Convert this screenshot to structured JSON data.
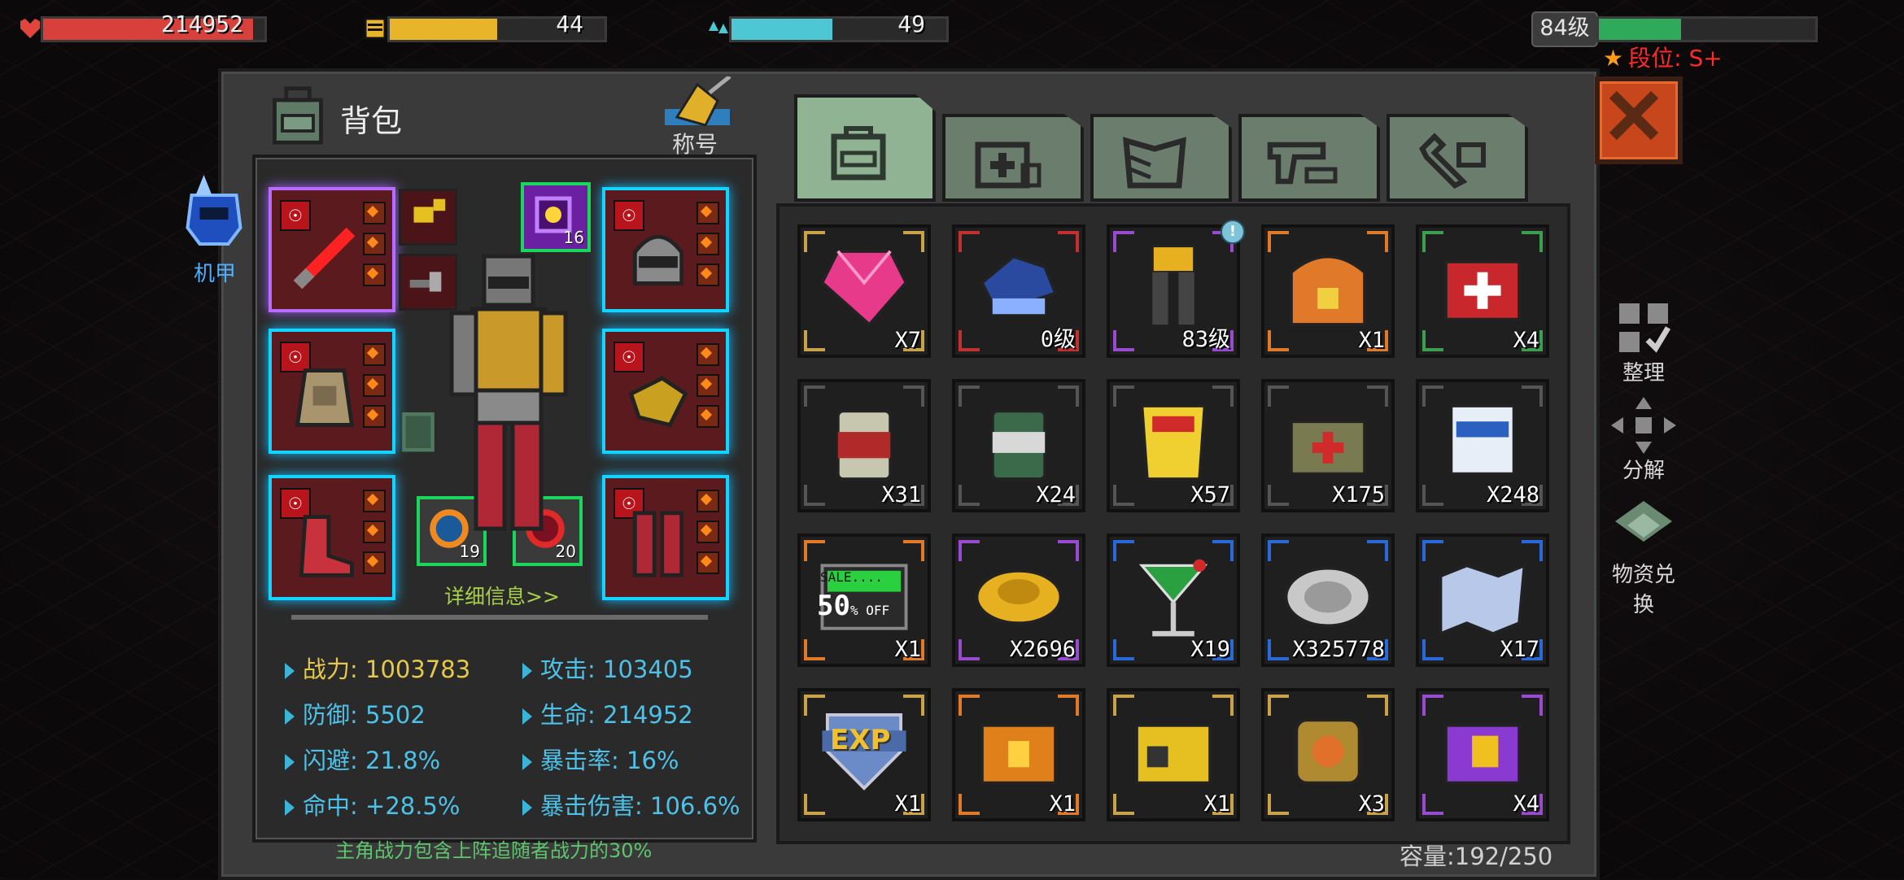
{
  "hud": {
    "hp": {
      "value": "214952",
      "fill": 0.95,
      "color": "#d8403c"
    },
    "energy": {
      "value": "44",
      "fill": 0.5,
      "color": "#e8b42a"
    },
    "water": {
      "value": "49",
      "fill": 0.47,
      "color": "#4ec7d4"
    },
    "level": {
      "label": "84级",
      "xp_fill": 0.38,
      "color": "#2eaa5a"
    },
    "rank": "段位: S+"
  },
  "panel": {
    "title": "背包",
    "title_badge_label": "称号",
    "mech_label": "机甲",
    "detail_link": "详细信息>>",
    "equipment_chips": [
      "16",
      "19",
      "20"
    ],
    "stats": [
      {
        "label": "战力",
        "value": "1003783"
      },
      {
        "label": "攻击",
        "value": "103405"
      },
      {
        "label": "防御",
        "value": "5502"
      },
      {
        "label": "生命",
        "value": "214952"
      },
      {
        "label": "闪避",
        "value": "21.8%"
      },
      {
        "label": "暴击率",
        "value": "16%"
      },
      {
        "label": "命中",
        "value": "+28.5%"
      },
      {
        "label": "暴击伤害",
        "value": "106.6%"
      }
    ],
    "note": "主角战力包含上阵追随者战力的30%"
  },
  "tabs": [
    {
      "icon": "backpack-icon",
      "active": true
    },
    {
      "icon": "medkit-icon",
      "active": false
    },
    {
      "icon": "armor-icon",
      "active": false
    },
    {
      "icon": "gun-icon",
      "active": false
    },
    {
      "icon": "wrench-icon",
      "active": false
    }
  ],
  "items": [
    {
      "name": "pink-gem",
      "qty": "X7",
      "frame": "#c9a24a"
    },
    {
      "name": "mech-glove",
      "qty": "0级",
      "frame": "#c23030"
    },
    {
      "name": "mech-legs",
      "qty": "83级",
      "frame": "#9a4ad0",
      "badge": "!"
    },
    {
      "name": "orange-crate",
      "qty": "X1",
      "frame": "#e07a2a"
    },
    {
      "name": "medical-pack",
      "qty": "X4",
      "frame": "#3aa050"
    },
    {
      "name": "bean-can",
      "qty": "X31",
      "frame": "#555555"
    },
    {
      "name": "soup-can",
      "qty": "X24",
      "frame": "#555555"
    },
    {
      "name": "chips-bag",
      "qty": "X57",
      "frame": "#555555"
    },
    {
      "name": "first-aid-bag",
      "qty": "X175",
      "frame": "#555555"
    },
    {
      "name": "salt-bag",
      "qty": "X248",
      "frame": "#555555"
    },
    {
      "name": "sale-coupon",
      "qty": "X1",
      "frame": "#e07a2a",
      "line1": "SALE....",
      "line2": "50",
      "line3": "% OFF"
    },
    {
      "name": "gold-coin",
      "qty": "X2696",
      "frame": "#9a4ad0"
    },
    {
      "name": "cocktail",
      "qty": "X19",
      "frame": "#2a6ad8"
    },
    {
      "name": "silver-coin",
      "qty": "X325778",
      "frame": "#2a6ad8"
    },
    {
      "name": "map",
      "qty": "X17",
      "frame": "#2a6ad8"
    },
    {
      "name": "exp-shield",
      "qty": "X1",
      "frame": "#c9a24a",
      "text": "EXP"
    },
    {
      "name": "orange-chest",
      "qty": "X1",
      "frame": "#e07a2a"
    },
    {
      "name": "gold-chest",
      "qty": "X1",
      "frame": "#c9a24a"
    },
    {
      "name": "gold-barrel",
      "qty": "X3",
      "frame": "#c9a24a"
    },
    {
      "name": "purple-chest",
      "qty": "X4",
      "frame": "#9a4ad0"
    }
  ],
  "capacity": "容量:192/250",
  "side_buttons": [
    "整理",
    "分解",
    "物资兑换"
  ]
}
